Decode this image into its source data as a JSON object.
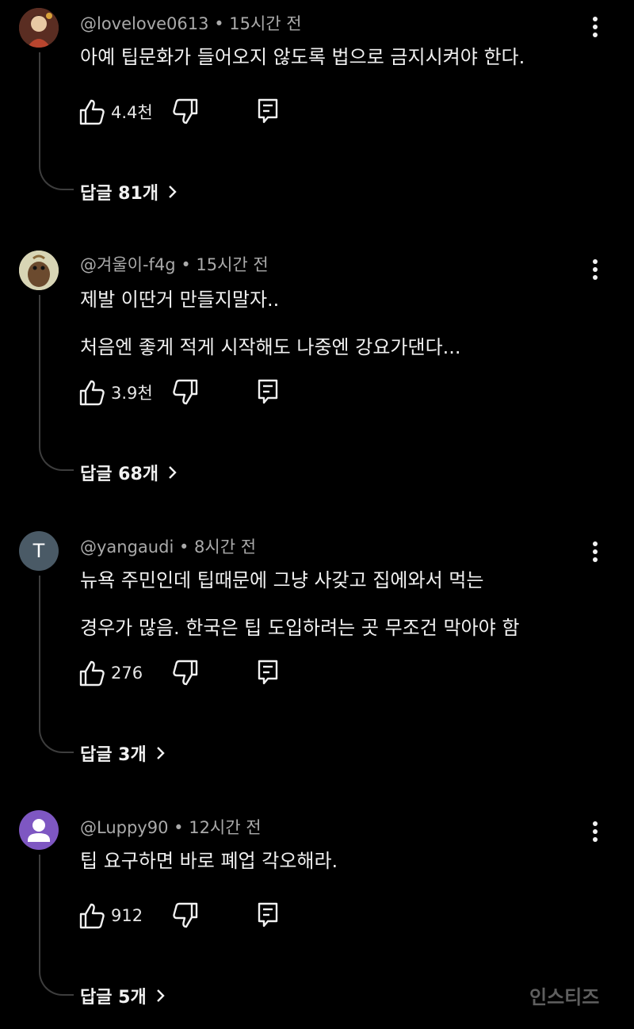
{
  "comments": [
    {
      "author": "@lovelove0613",
      "time": "15시간 전",
      "lines": [
        "아예 팁문화가 들어오지 않도록 법으로 금지시켜야 한다."
      ],
      "likes": "4.4천",
      "replies": "답글 81개",
      "avatar": {
        "type": "image",
        "icon": "illustrated-portrait",
        "color": "#b86d3b"
      }
    },
    {
      "author": "@겨울이-f4g",
      "time": "15시간 전",
      "lines": [
        "제발 이딴거 만들지말자..",
        "처음엔 좋게 적게 시작해도 나중엔 강요가댄다..."
      ],
      "likes": "3.9천",
      "replies": "답글 68개",
      "avatar": {
        "type": "image",
        "icon": "cartoon-face",
        "color": "#c5c2a0"
      }
    },
    {
      "author": "@yangaudi",
      "time": "8시간 전",
      "lines": [
        "뉴욕 주민인데 팁때문에 그냥 사갖고 집에와서 먹는",
        "경우가 많음. 한국은 팁 도입하려는 곳 무조건 막아야 함"
      ],
      "likes": "276",
      "replies": "답글 3개",
      "avatar": {
        "type": "letter",
        "letter": "T",
        "color": "#4a5a66"
      }
    },
    {
      "author": "@Luppy90",
      "time": "12시간 전",
      "lines": [
        "팁 요구하면 바로 폐업 각오해라."
      ],
      "likes": "912",
      "replies": "답글 5개",
      "avatar": {
        "type": "default",
        "icon": "user-silhouette",
        "color": "#7e57c2"
      }
    }
  ],
  "watermark": "인스티즈"
}
